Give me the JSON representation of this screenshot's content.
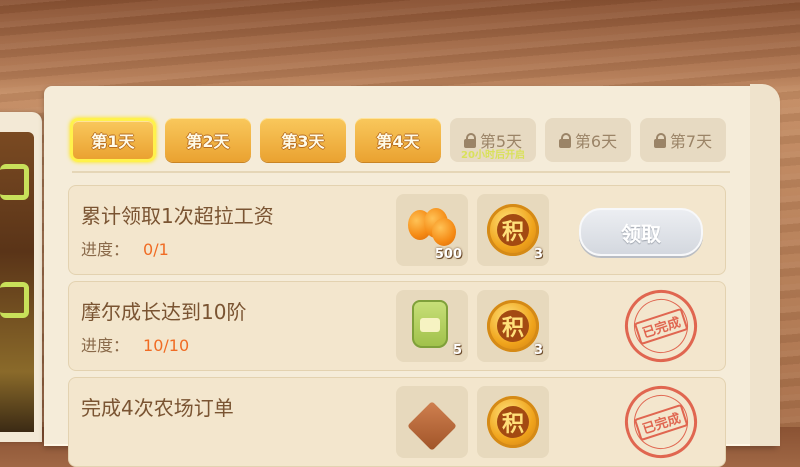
{
  "tabs": [
    {
      "label": "第1天",
      "state": "active"
    },
    {
      "label": "第2天",
      "state": "unlocked"
    },
    {
      "label": "第3天",
      "state": "unlocked"
    },
    {
      "label": "第4天",
      "state": "unlocked"
    },
    {
      "label": "第5天",
      "state": "locked",
      "sub": "20小时后开启"
    },
    {
      "label": "第6天",
      "state": "locked"
    },
    {
      "label": "第7天",
      "state": "locked"
    }
  ],
  "progress_label": "进度：",
  "tasks": [
    {
      "title": "累计领取1次超拉工资",
      "progress": "0/1",
      "rewards": [
        {
          "icon": "oranges-icon",
          "count": "500"
        },
        {
          "icon": "points-coin-icon",
          "mark": "积",
          "count": "3"
        }
      ],
      "action": {
        "type": "button",
        "label": "领取"
      }
    },
    {
      "title": "摩尔成长达到10阶",
      "progress": "10/10",
      "rewards": [
        {
          "icon": "fertilizer-bag-icon",
          "count": "5"
        },
        {
          "icon": "points-coin-icon",
          "mark": "积",
          "count": "3"
        }
      ],
      "action": {
        "type": "stamp",
        "label": "已完成"
      }
    },
    {
      "title": "完成4次农场订单",
      "progress": "",
      "rewards": [
        {
          "icon": "crate-icon",
          "count": ""
        },
        {
          "icon": "points-coin-icon",
          "mark": "积",
          "count": ""
        }
      ],
      "action": {
        "type": "stamp",
        "label": "已完成"
      }
    }
  ],
  "colors": {
    "tab_active": "#eaa231",
    "progress_value": "#f06c24",
    "stamp": "#e06650"
  }
}
